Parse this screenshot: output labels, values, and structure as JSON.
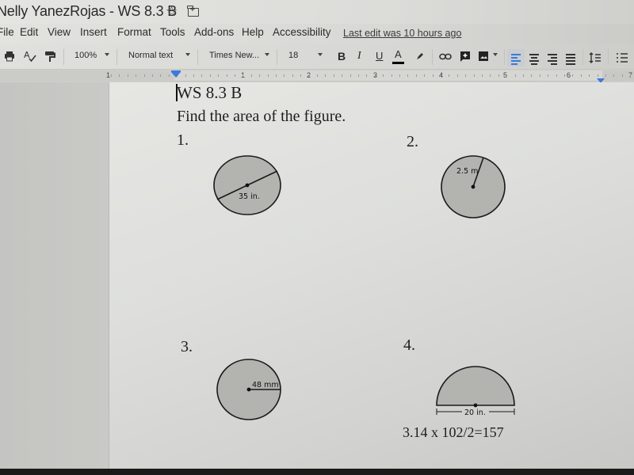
{
  "window": {
    "doc_title": "Nelly YanezRojas - WS 8.3 B",
    "star_icon": "☆"
  },
  "menu": {
    "items": [
      "File",
      "Edit",
      "View",
      "Insert",
      "Format",
      "Tools",
      "Add-ons",
      "Help",
      "Accessibility"
    ],
    "last_edit": "Last edit was 10 hours ago"
  },
  "toolbar": {
    "zoom": "100%",
    "style": "Normal text",
    "font": "Times New...",
    "font_size": "18",
    "bold": "B",
    "italic": "I",
    "underline": "U",
    "text_color": "A",
    "text_color_value": "#000000",
    "active_alignment": "left"
  },
  "ruler": {
    "labels": [
      "1",
      "1",
      "2",
      "3",
      "4",
      "5",
      "6",
      "7"
    ]
  },
  "document": {
    "heading": "WS 8.3 B",
    "instruction": "Find the area of the figure.",
    "problems": [
      {
        "number": "1.",
        "shape": "circle",
        "measure": "diameter",
        "label": "35 in."
      },
      {
        "number": "2.",
        "shape": "circle",
        "measure": "radius",
        "label": "2.5 m"
      },
      {
        "number": "3.",
        "shape": "circle",
        "measure": "radius",
        "label": "48 mm"
      },
      {
        "number": "4.",
        "shape": "semicircle",
        "measure": "diameter",
        "label": "20 in."
      }
    ],
    "answer_4": "3.14 x 102/2=157"
  },
  "colors": {
    "accent": "#3b7ad9",
    "figure_fill": "#b3b3b0",
    "figure_stroke": "#1a1a1a"
  }
}
